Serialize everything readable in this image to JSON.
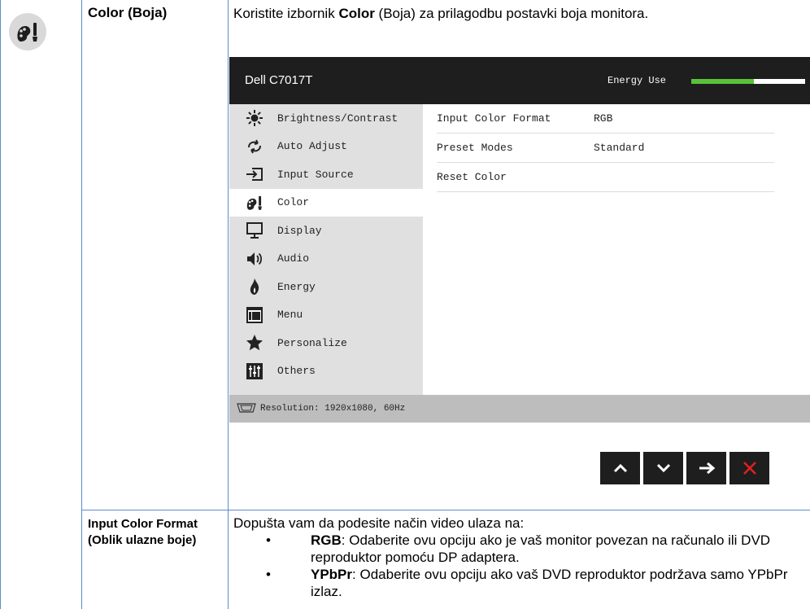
{
  "section": {
    "title": "Color (Boja)",
    "desc_prefix": "Koristite izbornik ",
    "desc_bold": "Color",
    "desc_suffix": " (Boja) za prilagodbu postavki boja monitora."
  },
  "osd": {
    "brand": "Dell C7017T",
    "energy_label": "Energy Use",
    "energy_level": 0.55,
    "menu": [
      {
        "label": "Brightness/Contrast",
        "icon": "sun-icon",
        "active": false
      },
      {
        "label": "Auto Adjust",
        "icon": "auto-adjust-icon",
        "active": false
      },
      {
        "label": "Input Source",
        "icon": "input-source-icon",
        "active": false
      },
      {
        "label": "Color",
        "icon": "color-palette-icon",
        "active": true
      },
      {
        "label": "Display",
        "icon": "monitor-icon",
        "active": false
      },
      {
        "label": "Audio",
        "icon": "speaker-icon",
        "active": false
      },
      {
        "label": "Energy",
        "icon": "flame-icon",
        "active": false
      },
      {
        "label": "Menu",
        "icon": "menu-window-icon",
        "active": false
      },
      {
        "label": "Personalize",
        "icon": "star-icon",
        "active": false
      },
      {
        "label": "Others",
        "icon": "sliders-icon",
        "active": false
      }
    ],
    "settings": [
      {
        "label": "Input Color Format",
        "value": "RGB"
      },
      {
        "label": "Preset Modes",
        "value": "Standard"
      },
      {
        "label": "Reset Color",
        "value": ""
      }
    ],
    "resolution": "Resolution: 1920x1080, 60Hz",
    "nav": [
      "up-arrow-icon",
      "down-arrow-icon",
      "right-arrow-icon",
      "close-icon"
    ],
    "colors": {
      "header": "#1e1e1e",
      "energy": "#5ac23a",
      "close": "#e02020"
    }
  },
  "subsection": {
    "title": "Input Color Format (Oblik ulazne boje)",
    "intro": "Dopušta vam da podesite način video ulaza na:",
    "bullets": [
      {
        "bold": "RGB",
        "text": ": Odaberite ovu opciju ako je vaš monitor povezan na računalo ili DVD reproduktor pomoću DP adaptera."
      },
      {
        "bold": "YPbPr",
        "text": ": Odaberite ovu opciju ako vaš DVD reproduktor podržava samo YPbPr izlaz."
      }
    ]
  }
}
